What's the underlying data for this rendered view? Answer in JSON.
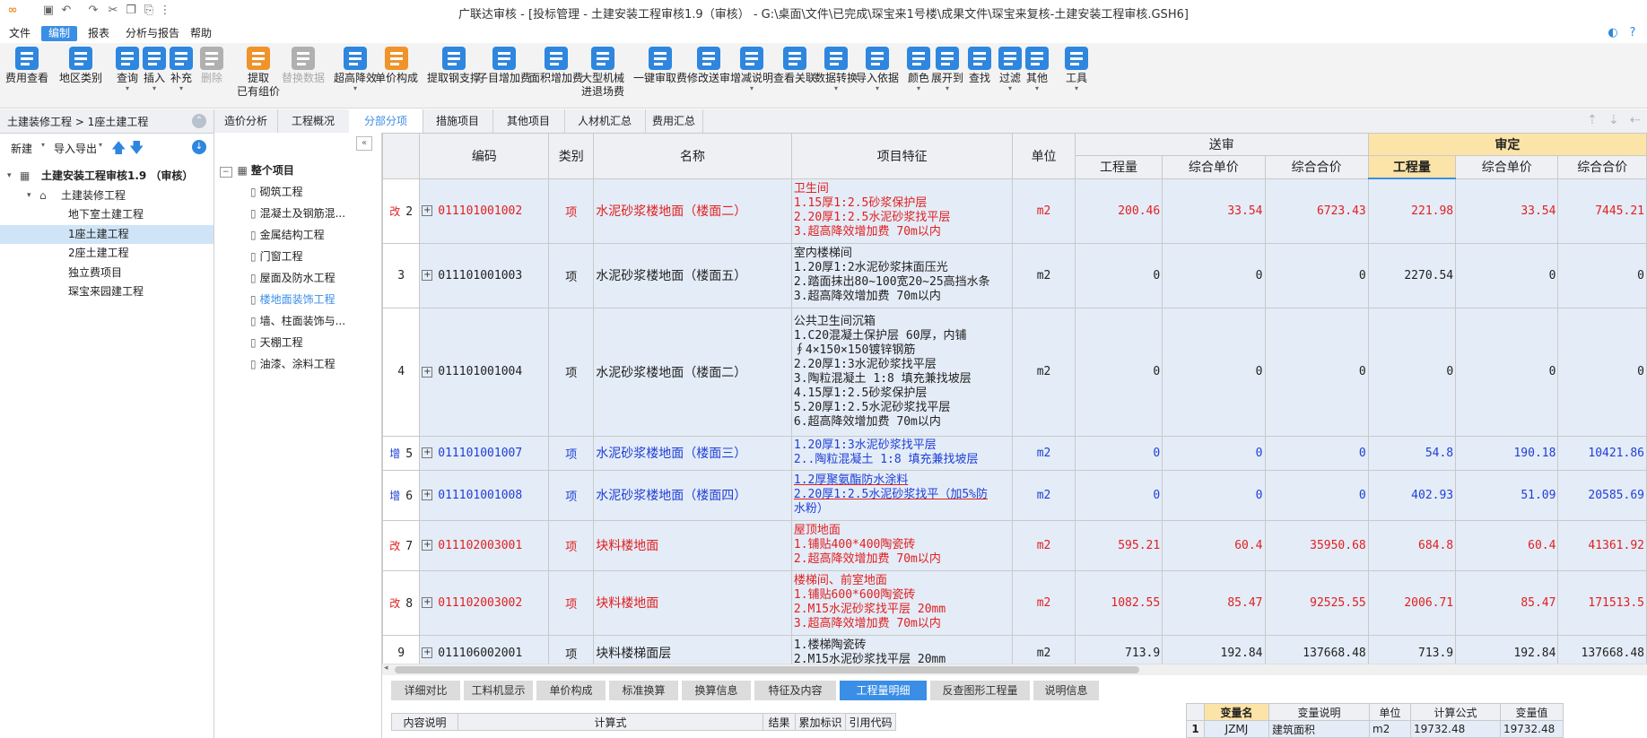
{
  "window": {
    "title": "广联达审核 - [投标管理 - 土建安装工程审核1.9（审核） - G:\\桌面\\文件\\已完成\\琛宝来1号楼\\成果文件\\琛宝来复核-土建安装工程审核.GSH6]"
  },
  "menubar": [
    "文件",
    "编制",
    "报表",
    "分析与报告",
    "帮助"
  ],
  "ribbon": [
    {
      "label": "费用查看",
      "sub": "",
      "color": "#2e86de"
    },
    {
      "label": "地区类别",
      "sub": "",
      "color": "#2e86de"
    },
    {
      "label": "查询",
      "sub": "▾",
      "color": "#2e86de"
    },
    {
      "label": "插入",
      "sub": "▾",
      "color": "#2e86de"
    },
    {
      "label": "补充",
      "sub": "▾",
      "color": "#2e86de"
    },
    {
      "label": "删除",
      "sub": "",
      "color": "#b0b0b0"
    },
    {
      "label": "提取",
      "sub": "已有组价",
      "color": "#f0932b"
    },
    {
      "label": "替换数据",
      "sub": "",
      "color": "#b0b0b0"
    },
    {
      "label": "超高降效",
      "sub": "▾",
      "color": "#2e86de"
    },
    {
      "label": "单价构成",
      "sub": "",
      "color": "#f0932b"
    },
    {
      "label": "提取钢支撑",
      "sub": "",
      "color": "#2e86de"
    },
    {
      "label": "子目增加费",
      "sub": "",
      "color": "#2e86de"
    },
    {
      "label": "面积增加费",
      "sub": "",
      "color": "#2e86de"
    },
    {
      "label": "大型机械",
      "sub": "进退场费",
      "color": "#2e86de"
    },
    {
      "label": "一键审取费",
      "sub": "",
      "color": "#2e86de"
    },
    {
      "label": "修改送审",
      "sub": "",
      "color": "#2e86de"
    },
    {
      "label": "增减说明",
      "sub": "▾",
      "color": "#2e86de"
    },
    {
      "label": "查看关联",
      "sub": "",
      "color": "#2e86de"
    },
    {
      "label": "数据转换",
      "sub": "▾",
      "color": "#2e86de"
    },
    {
      "label": "导入依据",
      "sub": "▾",
      "color": "#2e86de"
    },
    {
      "label": "颜色",
      "sub": "▾",
      "color": "#2e86de"
    },
    {
      "label": "展开到",
      "sub": "▾",
      "color": "#2e86de"
    },
    {
      "label": "查找",
      "sub": "",
      "color": "#2e86de"
    },
    {
      "label": "过滤",
      "sub": "▾",
      "color": "#2e86de"
    },
    {
      "label": "其他",
      "sub": "▾",
      "color": "#2e86de"
    },
    {
      "label": "工具",
      "sub": "▾",
      "color": "#2e86de"
    }
  ],
  "left": {
    "breadcrumb": "土建装修工程 > 1座土建工程",
    "toolbar": {
      "new": "新建",
      "import": "导入导出"
    },
    "tree": [
      {
        "label": "土建安装工程审核1.9 （审核）",
        "bold": true
      },
      {
        "label": "土建装修工程",
        "bold": false
      },
      {
        "label": "地下室土建工程",
        "bold": false
      },
      {
        "label": "1座土建工程",
        "bold": false
      },
      {
        "label": "2座土建工程",
        "bold": false
      },
      {
        "label": "独立费项目",
        "bold": false
      },
      {
        "label": "琛宝来园建工程",
        "bold": false
      }
    ]
  },
  "tabs": [
    "造价分析",
    "工程概况",
    "分部分项",
    "措施项目",
    "其他项目",
    "人材机汇总",
    "费用汇总"
  ],
  "mid": {
    "root": "整个项目",
    "items": [
      "砌筑工程",
      "混凝土及钢筋混...",
      "金属结构工程",
      "门窗工程",
      "屋面及防水工程",
      "楼地面装饰工程",
      "墙、柱面装饰与...",
      "天棚工程",
      "油漆、涂料工程"
    ]
  },
  "grid": {
    "headers": {
      "code": "编码",
      "type": "类别",
      "name": "名称",
      "feature": "项目特征",
      "unit": "单位",
      "submitted": "送审",
      "approved": "审定",
      "qty": "工程量",
      "unit_price": "综合单价",
      "total_price": "综合合价"
    },
    "rows": [
      {
        "mark": "改",
        "no": "2",
        "code": "011101001002",
        "type": "项",
        "name": "水泥砂浆楼地面（楼面二）",
        "feature": [
          "卫生间",
          "1.15厚1:2.5砂浆保护层",
          "2.20厚1:2.5水泥砂浆找平层",
          "3.超高降效增加费 70m以内"
        ],
        "unit": "m2",
        "s_qty": "200.46",
        "s_price": "33.54",
        "s_total": "6723.43",
        "a_qty": "221.98",
        "a_price": "33.54",
        "a_total": "7445.21",
        "color": "red"
      },
      {
        "mark": "",
        "no": "3",
        "code": "011101001003",
        "type": "项",
        "name": "水泥砂浆楼地面（楼面五）",
        "feature": [
          "室内楼梯间",
          "1.20厚1:2水泥砂浆抹面压光",
          "2.踏面抹出80~100宽20~25高挡水条",
          "3.超高降效增加费 70m以内"
        ],
        "unit": "m2",
        "s_qty": "0",
        "s_price": "0",
        "s_total": "0",
        "a_qty": "2270.54",
        "a_price": "0",
        "a_total": "0",
        "color": "blk"
      },
      {
        "mark": "",
        "no": "4",
        "code": "011101001004",
        "type": "项",
        "name": "水泥砂浆楼地面（楼面二）",
        "feature": [
          "公共卫生间沉箱",
          "1.C20混凝土保护层 60厚，内铺",
          "∮4×150×150镀锌钢筋",
          "2.20厚1:3水泥砂浆找平层",
          "3.陶粒混凝土 1:8 填充兼找坡层",
          "4.15厚1:2.5砂浆保护层",
          "5.20厚1:2.5水泥砂浆找平层",
          "6.超高降效增加费 70m以内"
        ],
        "unit": "m2",
        "s_qty": "0",
        "s_price": "0",
        "s_total": "0",
        "a_qty": "0",
        "a_price": "0",
        "a_total": "0",
        "color": "blk"
      },
      {
        "mark": "增",
        "no": "5",
        "code": "011101001007",
        "type": "项",
        "name": "水泥砂浆楼地面（楼面三）",
        "feature": [
          "1.20厚1:3水泥砂浆找平层",
          "2..陶粒混凝土 1:8 填充兼找坡层"
        ],
        "unit": "m2",
        "s_qty": "0",
        "s_price": "0",
        "s_total": "0",
        "a_qty": "54.8",
        "a_price": "190.18",
        "a_total": "10421.86",
        "color": "blue"
      },
      {
        "mark": "增",
        "no": "6",
        "code": "011101001008",
        "type": "项",
        "name": "水泥砂浆楼地面（楼面四）",
        "feature": [
          "1.2厚聚氨酯防水涂料",
          "2.20厚1:2.5水泥砂浆找平（加5%防",
          "水粉）"
        ],
        "unit": "m2",
        "s_qty": "0",
        "s_price": "0",
        "s_total": "0",
        "a_qty": "402.93",
        "a_price": "51.09",
        "a_total": "20585.69",
        "color": "blue"
      },
      {
        "mark": "改",
        "no": "7",
        "code": "011102003001",
        "type": "项",
        "name": "块料楼地面",
        "feature": [
          "屋顶地面",
          "1.铺贴400*400陶瓷砖",
          "2.超高降效增加费 70m以内"
        ],
        "unit": "m2",
        "s_qty": "595.21",
        "s_price": "60.4",
        "s_total": "35950.68",
        "a_qty": "684.8",
        "a_price": "60.4",
        "a_total": "41361.92",
        "color": "red"
      },
      {
        "mark": "改",
        "no": "8",
        "code": "011102003002",
        "type": "项",
        "name": "块料楼地面",
        "feature": [
          "楼梯间、前室地面",
          "1.铺贴600*600陶瓷砖",
          "2.M15水泥砂浆找平层 20mm",
          "3.超高降效增加费 70m以内"
        ],
        "unit": "m2",
        "s_qty": "1082.55",
        "s_price": "85.47",
        "s_total": "92525.55",
        "a_qty": "2006.71",
        "a_price": "85.47",
        "a_total": "171513.5",
        "color": "red"
      },
      {
        "mark": "",
        "no": "9",
        "code": "011106002001",
        "type": "项",
        "name": "块料楼梯面层",
        "feature": [
          "1.楼梯陶瓷砖",
          "2.M15水泥砂浆找平层 20mm"
        ],
        "unit": "m2",
        "s_qty": "713.9",
        "s_price": "192.84",
        "s_total": "137668.48",
        "a_qty": "713.9",
        "a_price": "192.84",
        "a_total": "137668.48",
        "color": "blk"
      }
    ]
  },
  "bottom_tabs": [
    "详细对比",
    "工料机显示",
    "单价构成",
    "标准换算",
    "换算信息",
    "特征及内容",
    "工程量明细",
    "反查图形工程量",
    "说明信息"
  ],
  "bottom_left_headers": [
    "内容说明",
    "计算式",
    "结果",
    "累加标识",
    "引用代码"
  ],
  "bottom_right": {
    "headers": [
      "变量名",
      "变量说明",
      "单位",
      "计算公式",
      "变量值"
    ],
    "row": {
      "no": "1",
      "name": "JZMJ",
      "desc": "建筑面积",
      "unit": "m2",
      "formula": "19732.48",
      "value": "19732.48"
    }
  }
}
